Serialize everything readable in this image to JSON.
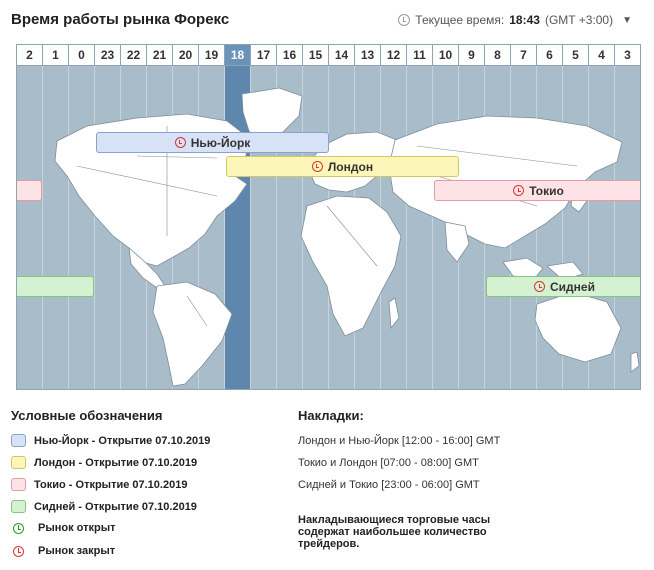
{
  "header": {
    "title": "Время работы рынка Форекс",
    "current_time_label": "Текущее время:",
    "current_time": "18:43",
    "timezone": "(GMT +3:00)"
  },
  "map": {
    "hours": [
      "2",
      "1",
      "0",
      "23",
      "22",
      "21",
      "20",
      "19",
      "18",
      "17",
      "16",
      "15",
      "14",
      "13",
      "12",
      "11",
      "10",
      "9",
      "8",
      "7",
      "6",
      "5",
      "4",
      "3"
    ],
    "active_hour": "18"
  },
  "sessions": [
    {
      "id": "ny",
      "label": "Нью-Йорк",
      "status": "closed"
    },
    {
      "id": "ld",
      "label": "Лондон",
      "status": "closed"
    },
    {
      "id": "tk",
      "label": "Токио",
      "status": "closed"
    },
    {
      "id": "sd",
      "label": "Сидней",
      "status": "closed"
    }
  ],
  "legend": {
    "title": "Условные обозначения",
    "items": [
      "Нью-Йорк - Открытие 07.10.2019",
      "Лондон - Открытие 07.10.2019",
      "Токио - Открытие 07.10.2019",
      "Сидней - Открытие 07.10.2019"
    ],
    "open_label": "Рынок открыт",
    "closed_label": "Рынок закрыт"
  },
  "overlaps": {
    "title": "Накладки:",
    "items": [
      "Лондон и Нью-Йорк [12:00 - 16:00] GMT",
      "Токио и Лондон [07:00 - 08:00] GMT",
      "Сидней и Токио [23:00 - 06:00] GMT"
    ],
    "note": "Накладывающиеся торговые часы содержат наибольшее количество трейдеров."
  },
  "colors": {
    "ny": "#d7e2f7",
    "london": "#fcf6b8",
    "tokyo": "#fde3e6",
    "sydney": "#d4f2d2",
    "active_column": "#5f87ad",
    "ocean": "#a9bcca"
  }
}
